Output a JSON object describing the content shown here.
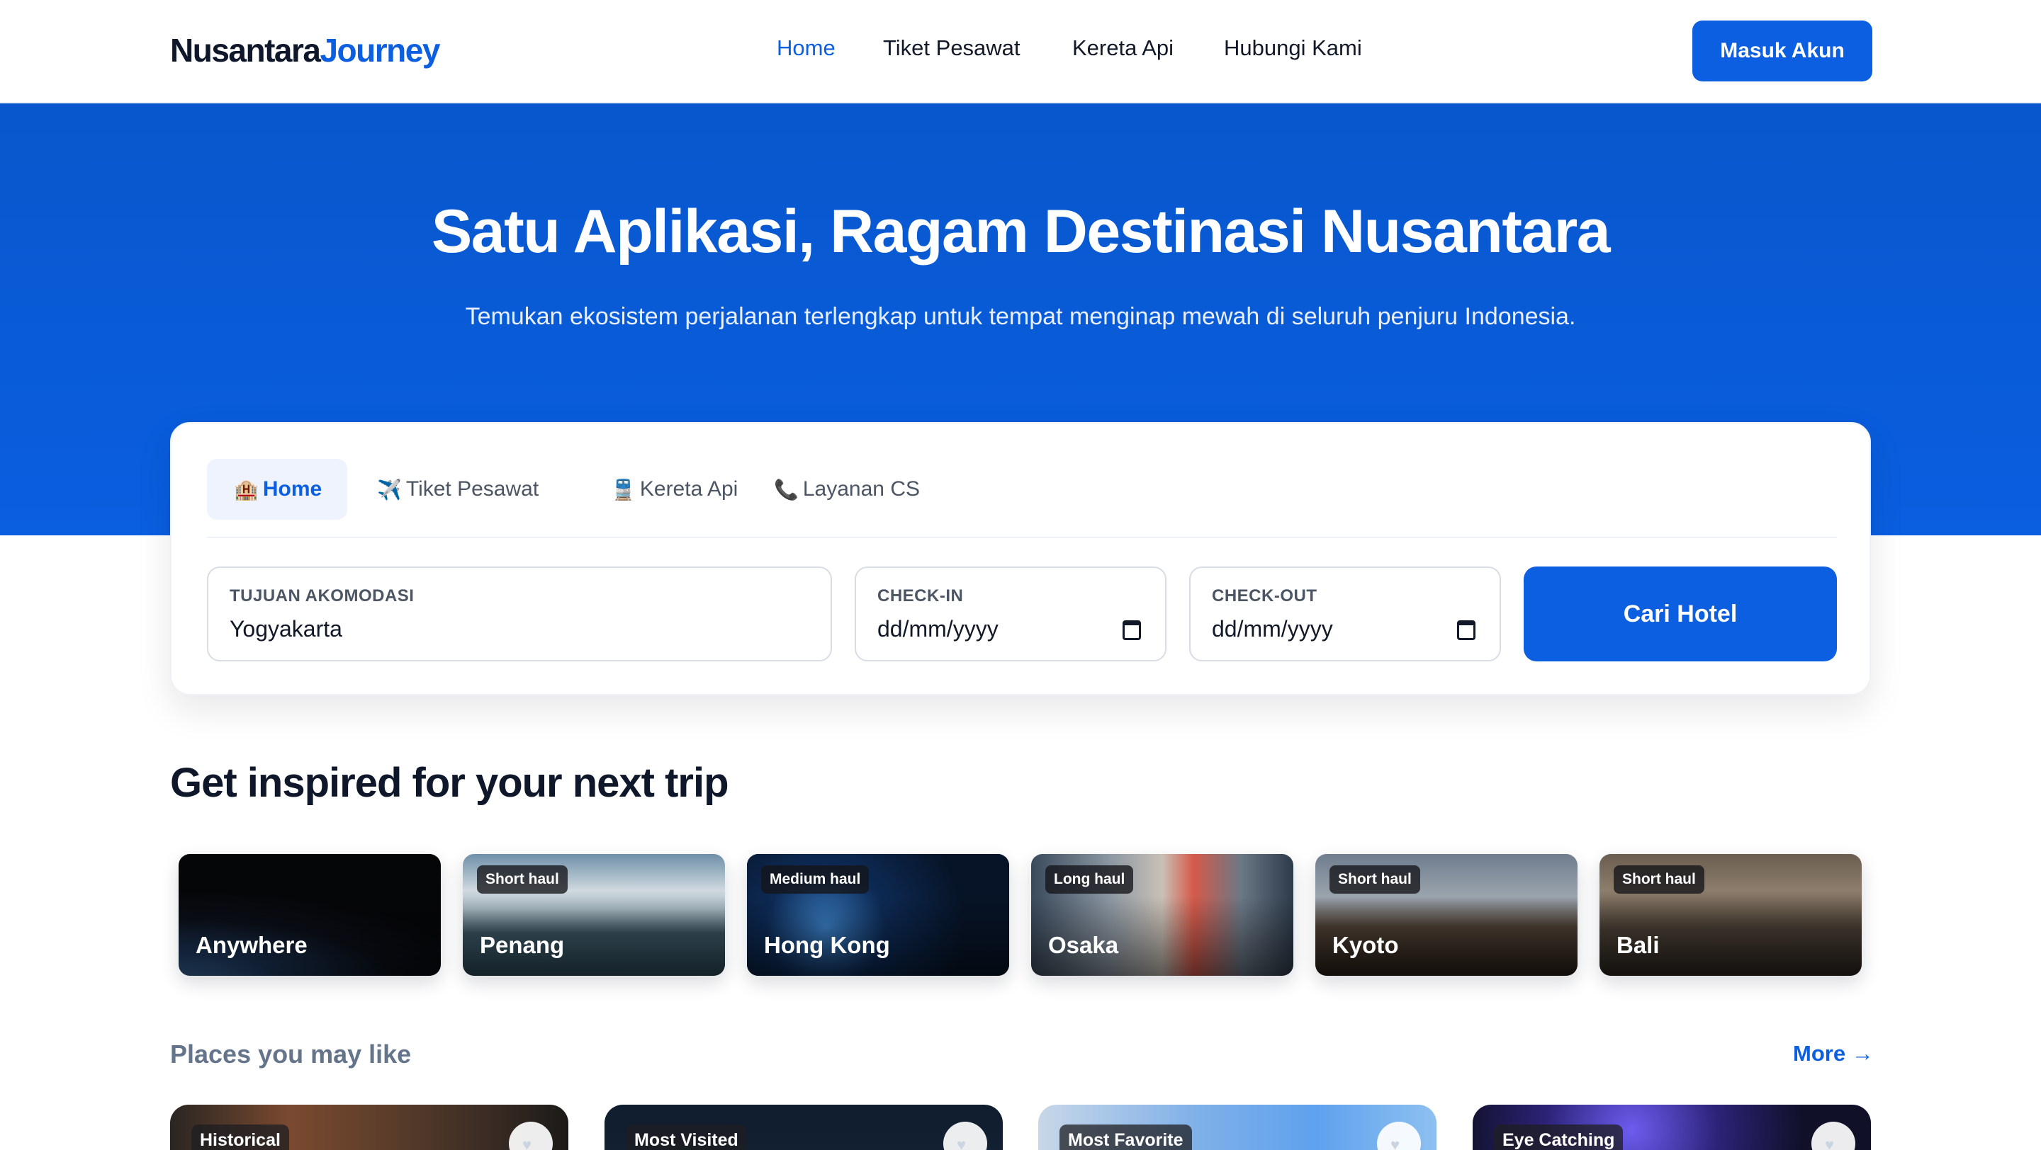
{
  "brand": {
    "part1": "Nusantara",
    "part2": "Journey"
  },
  "nav": {
    "links": [
      {
        "label": "Home",
        "active": true
      },
      {
        "label": "Tiket Pesawat",
        "active": false
      },
      {
        "label": "Kereta Api",
        "active": false
      },
      {
        "label": "Hubungi Kami",
        "active": false
      }
    ],
    "login_label": "Masuk Akun"
  },
  "hero": {
    "title": "Satu Aplikasi, Ragam Destinasi Nusantara",
    "subtitle": "Temukan ekosistem perjalanan terlengkap untuk tempat menginap mewah di seluruh penjuru Indonesia."
  },
  "search": {
    "tabs": [
      {
        "icon": "🏨",
        "label": "Home",
        "active": true
      },
      {
        "icon": "✈️",
        "label": "Tiket Pesawat",
        "active": false
      },
      {
        "icon": "🚆",
        "label": "Kereta Api",
        "active": false
      },
      {
        "icon": "📞",
        "label": "Layanan CS",
        "active": false
      }
    ],
    "destination": {
      "label": "TUJUAN AKOMODASI",
      "value": "Yogyakarta"
    },
    "checkin": {
      "label": "CHECK-IN",
      "value": "dd/mm/yyyy"
    },
    "checkout": {
      "label": "CHECK-OUT",
      "value": "dd/mm/yyyy"
    },
    "button_label": "Cari Hotel"
  },
  "inspire": {
    "title": "Get inspired for your next trip",
    "cards": [
      {
        "badge": "",
        "city": "Anywhere"
      },
      {
        "badge": "Short haul",
        "city": "Penang"
      },
      {
        "badge": "Medium haul",
        "city": "Hong Kong"
      },
      {
        "badge": "Long haul",
        "city": "Osaka"
      },
      {
        "badge": "Short haul",
        "city": "Kyoto"
      },
      {
        "badge": "Short haul",
        "city": "Bali"
      }
    ]
  },
  "places": {
    "title": "Places you may like",
    "more_label": "More →",
    "cards": [
      {
        "badge": "Historical"
      },
      {
        "badge": "Most Visited"
      },
      {
        "badge": "Most Favorite"
      },
      {
        "badge": "Eye Catching"
      }
    ]
  },
  "colors": {
    "primary": "#0b5fe0",
    "hero": "#0857cc",
    "text": "#0f172a"
  }
}
